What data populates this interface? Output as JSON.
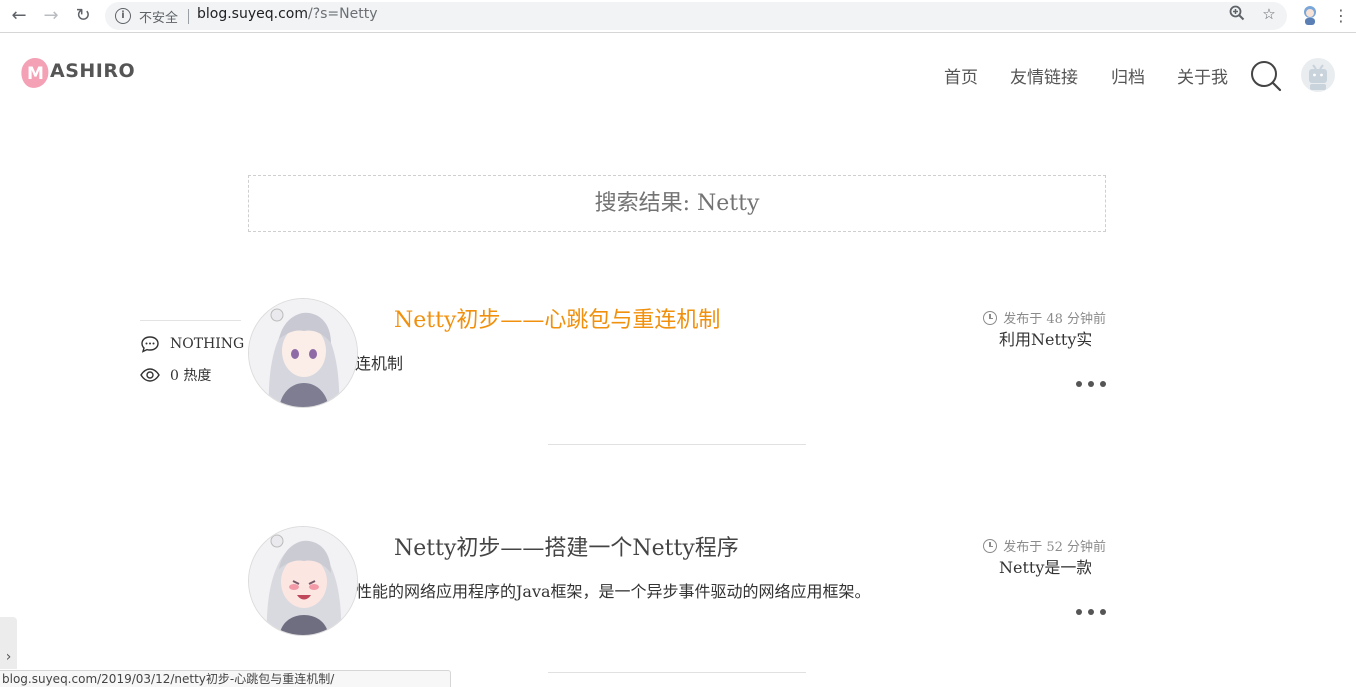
{
  "browser": {
    "back_icon": "arrow-left-icon",
    "forward_icon": "arrow-right-icon",
    "reload_icon": "reload-icon",
    "security_label": "不安全",
    "url_host": "blog.suyeq.com",
    "url_path": "/?s=Netty",
    "zoom_icon": "zoom-icon",
    "bookmark_icon": "star-icon",
    "menu_icon": "kebab-menu-icon"
  },
  "site": {
    "logo_text": "ASHIRO",
    "logo_letter": "M",
    "brand_color": "#f4a0b5",
    "nav": [
      {
        "label": "首页"
      },
      {
        "label": "友情链接"
      },
      {
        "label": "归档"
      },
      {
        "label": "关于我"
      }
    ]
  },
  "search": {
    "title": "搜索结果: Netty"
  },
  "posts": [
    {
      "title": "Netty初步——心跳包与重连机制",
      "title_color": "#f0900d",
      "excerpt_visible": "连机制",
      "date": "发布于 48 分钟前",
      "side_excerpt": "利用Netty实",
      "meta": {
        "comments": "NOTHING",
        "views": "0 热度"
      }
    },
    {
      "title": "Netty初步——搭建一个Netty程序",
      "title_color": "#444444",
      "excerpt_visible": "高性能的网络应用程序的Java框架，是一个异步事件驱动的网络应用框架。",
      "date": "发布于 52 分钟前",
      "side_excerpt": "Netty是一款"
    }
  ],
  "status_bar": {
    "url": "blog.suyeq.com/2019/03/12/netty初步-心跳包与重连机制/"
  },
  "side_tab": {
    "icon": "chevron-right-icon"
  }
}
